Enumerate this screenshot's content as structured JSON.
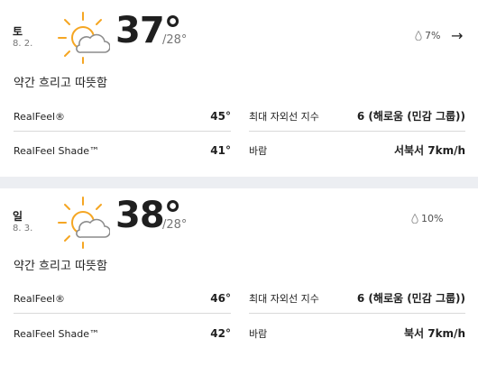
{
  "days": [
    {
      "day": "토",
      "date": "8. 2.",
      "icon": "partly-sunny-icon",
      "high": "37°",
      "low": "/28°",
      "precip": "7%",
      "phrase": "약간 흐리고 따뜻함",
      "realfeel_label": "RealFeel®",
      "realfeel_value": "45°",
      "shade_label": "RealFeel Shade™",
      "shade_value": "41°",
      "uv_label": "최대 자외선 지수",
      "uv_value": "6 (해로움 (민감 그룹))",
      "wind_label": "바람",
      "wind_value": "서북서 7km/h"
    },
    {
      "day": "일",
      "date": "8. 3.",
      "icon": "partly-sunny-icon",
      "high": "38°",
      "low": "/28°",
      "precip": "10%",
      "phrase": "약간 흐리고 따뜻함",
      "realfeel_label": "RealFeel®",
      "realfeel_value": "46°",
      "shade_label": "RealFeel Shade™",
      "shade_value": "42°",
      "uv_label": "최대 자외선 지수",
      "uv_value": "6 (해로움 (민감 그룹))",
      "wind_label": "바람",
      "wind_value": "북서 7km/h"
    }
  ],
  "colors": {
    "sun": "#f5a623",
    "cloud": "#8c8c8c",
    "divider": "#d9d9d9",
    "background": "#eceef2"
  }
}
